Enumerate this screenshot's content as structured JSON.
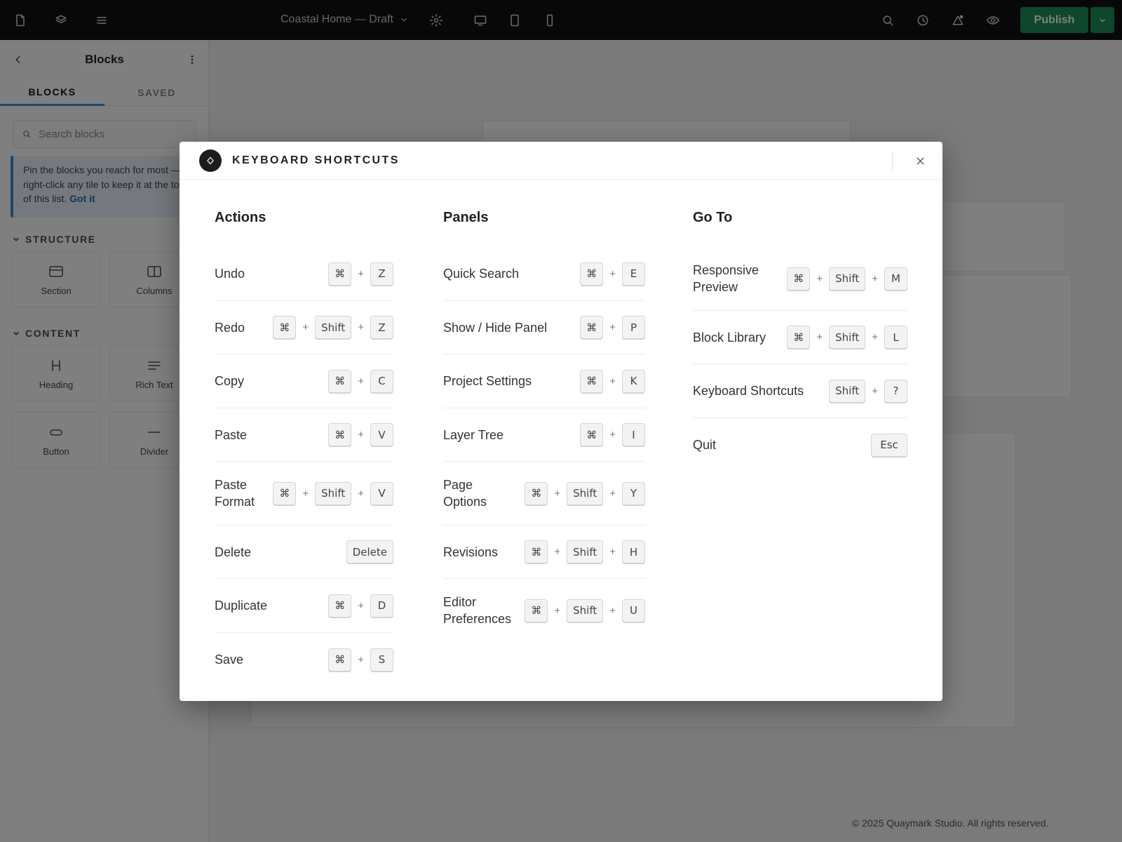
{
  "topbar": {
    "doc_title": "Coastal Home — Draft",
    "publish_label": "Publish"
  },
  "sidebar": {
    "title": "Blocks",
    "tabs": [
      "BLOCKS",
      "SAVED"
    ],
    "search_placeholder": "Search blocks",
    "tip_text": "Pin the blocks you reach for most — right-click any tile to keep it at the top of this list.",
    "tip_link": "Got it",
    "sections": [
      {
        "label": "STRUCTURE",
        "tiles": [
          "Section",
          "Columns"
        ]
      },
      {
        "label": "CONTENT",
        "tiles": [
          "Heading",
          "Rich Text",
          "Button",
          "Divider"
        ]
      }
    ]
  },
  "canvas": {
    "footer_text": "© 2025 Quaymark Studio. All rights reserved."
  },
  "modal": {
    "title": "KEYBOARD SHORTCUTS",
    "plus": "+",
    "columns": [
      {
        "title": "Actions",
        "rows": [
          {
            "label": "Undo",
            "keys": [
              "⌘",
              "Z"
            ]
          },
          {
            "label": "Redo",
            "keys": [
              "⌘",
              "Shift",
              "Z"
            ]
          },
          {
            "label": "Copy",
            "keys": [
              "⌘",
              "C"
            ]
          },
          {
            "label": "Paste",
            "keys": [
              "⌘",
              "V"
            ]
          },
          {
            "label": "Paste Format",
            "keys": [
              "⌘",
              "Shift",
              "V"
            ]
          },
          {
            "label": "Delete",
            "keys": [
              "Delete"
            ]
          },
          {
            "label": "Duplicate",
            "keys": [
              "⌘",
              "D"
            ]
          },
          {
            "label": "Save",
            "keys": [
              "⌘",
              "S"
            ]
          }
        ]
      },
      {
        "title": "Panels",
        "rows": [
          {
            "label": "Quick Search",
            "keys": [
              "⌘",
              "E"
            ]
          },
          {
            "label": "Show / Hide Panel",
            "keys": [
              "⌘",
              "P"
            ]
          },
          {
            "label": "Project Settings",
            "keys": [
              "⌘",
              "K"
            ]
          },
          {
            "label": "Layer Tree",
            "keys": [
              "⌘",
              "I"
            ]
          },
          {
            "label": "Page Options",
            "keys": [
              "⌘",
              "Shift",
              "Y"
            ]
          },
          {
            "label": "Revisions",
            "keys": [
              "⌘",
              "Shift",
              "H"
            ]
          },
          {
            "label": "Editor Preferences",
            "keys": [
              "⌘",
              "Shift",
              "U"
            ]
          }
        ]
      },
      {
        "title": "Go To",
        "rows": [
          {
            "label": "Responsive Preview",
            "keys": [
              "⌘",
              "Shift",
              "M"
            ]
          },
          {
            "label": "Block Library",
            "keys": [
              "⌘",
              "Shift",
              "L"
            ]
          },
          {
            "label": "Keyboard Shortcuts",
            "keys": [
              "Shift",
              "?"
            ]
          },
          {
            "label": "Quit",
            "keys": [
              "Esc"
            ]
          }
        ]
      }
    ]
  },
  "colors": {
    "topbar_bg": "#101010",
    "publish": "#1f8f5b",
    "accent": "#3a8fd0",
    "overlay": "rgba(0,0,0,0.5)"
  }
}
